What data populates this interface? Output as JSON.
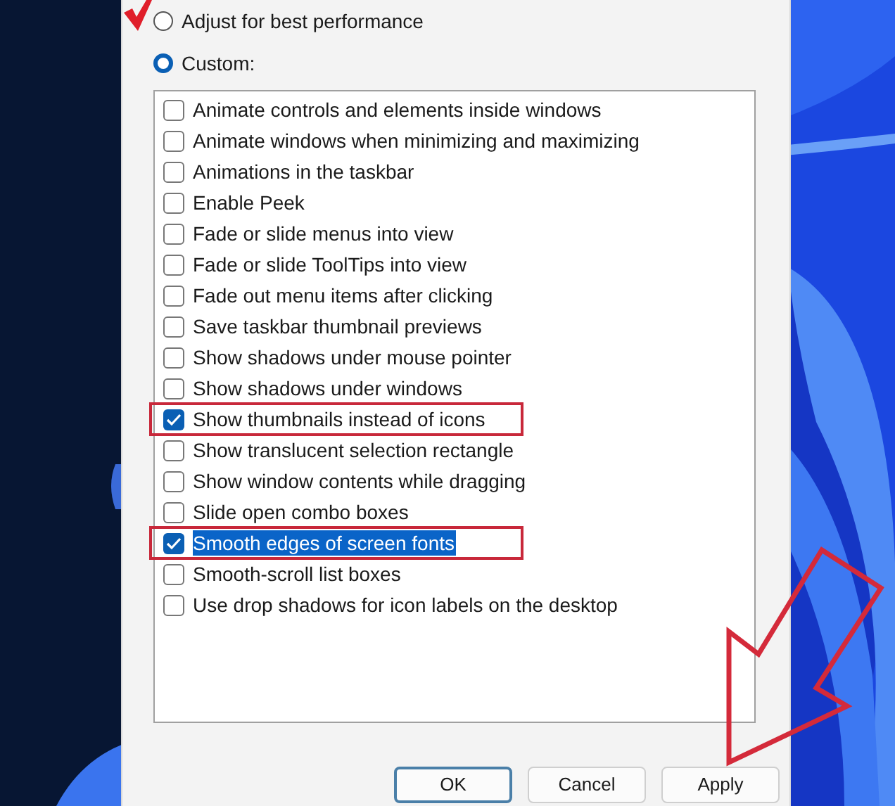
{
  "options": [
    {
      "label": "Adjust for best performance",
      "selected": false
    },
    {
      "label": "Custom:",
      "selected": true
    }
  ],
  "settings": [
    {
      "label": "Animate controls and elements inside windows",
      "checked": false,
      "selected": false,
      "annotated": false
    },
    {
      "label": "Animate windows when minimizing and maximizing",
      "checked": false,
      "selected": false,
      "annotated": false
    },
    {
      "label": "Animations in the taskbar",
      "checked": false,
      "selected": false,
      "annotated": false
    },
    {
      "label": "Enable Peek",
      "checked": false,
      "selected": false,
      "annotated": false
    },
    {
      "label": "Fade or slide menus into view",
      "checked": false,
      "selected": false,
      "annotated": false
    },
    {
      "label": "Fade or slide ToolTips into view",
      "checked": false,
      "selected": false,
      "annotated": false
    },
    {
      "label": "Fade out menu items after clicking",
      "checked": false,
      "selected": false,
      "annotated": false
    },
    {
      "label": "Save taskbar thumbnail previews",
      "checked": false,
      "selected": false,
      "annotated": false
    },
    {
      "label": "Show shadows under mouse pointer",
      "checked": false,
      "selected": false,
      "annotated": false
    },
    {
      "label": "Show shadows under windows",
      "checked": false,
      "selected": false,
      "annotated": false
    },
    {
      "label": "Show thumbnails instead of icons",
      "checked": true,
      "selected": false,
      "annotated": true
    },
    {
      "label": "Show translucent selection rectangle",
      "checked": false,
      "selected": false,
      "annotated": false
    },
    {
      "label": "Show window contents while dragging",
      "checked": false,
      "selected": false,
      "annotated": false
    },
    {
      "label": "Slide open combo boxes",
      "checked": false,
      "selected": false,
      "annotated": false
    },
    {
      "label": "Smooth edges of screen fonts",
      "checked": true,
      "selected": true,
      "annotated": true
    },
    {
      "label": "Smooth-scroll list boxes",
      "checked": false,
      "selected": false,
      "annotated": false
    },
    {
      "label": "Use drop shadows for icon labels on the desktop",
      "checked": false,
      "selected": false,
      "annotated": false
    }
  ],
  "buttons": [
    {
      "label": "OK",
      "default": true
    },
    {
      "label": "Cancel",
      "default": false
    },
    {
      "label": "Apply",
      "default": false
    }
  ]
}
